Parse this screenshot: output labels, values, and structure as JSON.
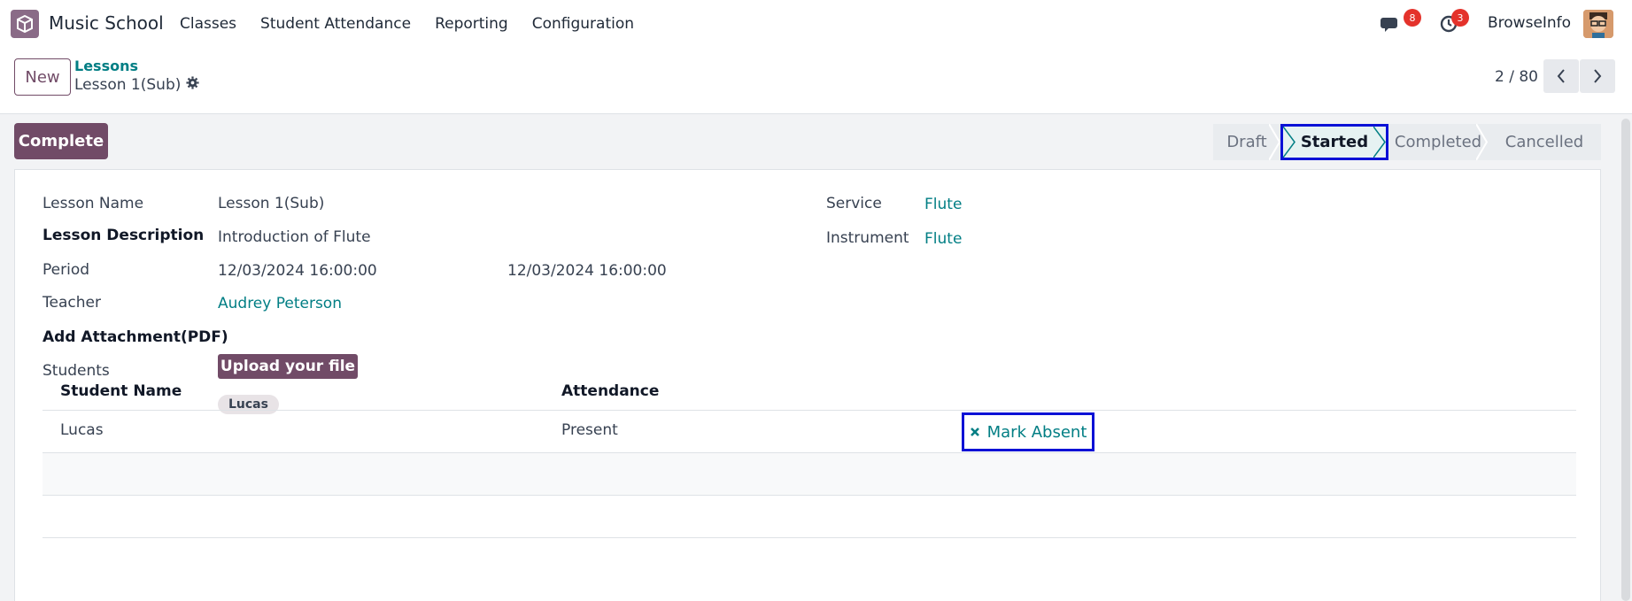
{
  "app": {
    "name": "Music School",
    "icon": "cube-icon",
    "brand_color": "#714b67"
  },
  "menu": [
    "Classes",
    "Student Attendance",
    "Reporting",
    "Configuration"
  ],
  "navbar": {
    "messages_count": "8",
    "activities_count": "3",
    "company": "BrowseInfo"
  },
  "control": {
    "new_label": "New",
    "breadcrumb_parent": "Lessons",
    "breadcrumb_current": "Lesson 1(Sub)",
    "pager": "2 / 80"
  },
  "actions": {
    "complete_label": "Complete"
  },
  "stages": [
    "Draft",
    "Started",
    "Completed",
    "Cancelled"
  ],
  "active_stage": "Started",
  "form": {
    "lesson_name_label": "Lesson Name",
    "lesson_name": "Lesson 1(Sub)",
    "description_label": "Lesson Description",
    "description": "Introduction of Flute",
    "period_label": "Period",
    "period_start": "12/03/2024 16:00:00",
    "period_end": "12/03/2024 16:00:00",
    "teacher_label": "Teacher",
    "teacher": "Audrey Peterson",
    "attachment_label": "Add Attachment(PDF)",
    "upload_label": "Upload your file",
    "students_label": "Students",
    "student_tag": "Lucas",
    "service_label": "Service",
    "service": "Flute",
    "instrument_label": "Instrument",
    "instrument": "Flute"
  },
  "table": {
    "headers": [
      "Student Name",
      "Attendance"
    ],
    "rows": [
      {
        "student": "Lucas",
        "attendance": "Present",
        "action": "Mark Absent"
      }
    ]
  }
}
